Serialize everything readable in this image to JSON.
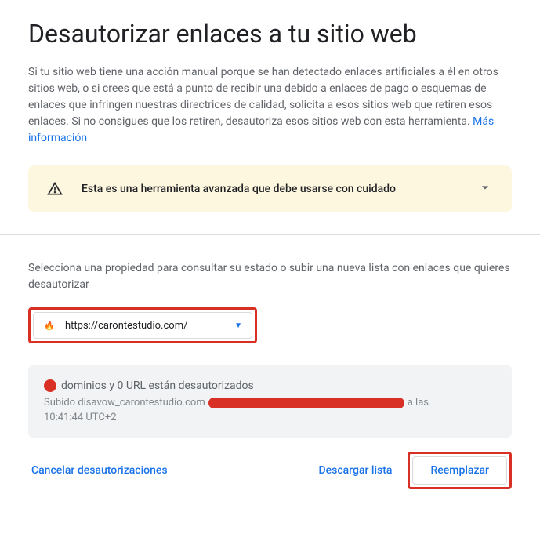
{
  "title": "Desautorizar enlaces a tu sitio web",
  "description": "Si tu sitio web tiene una acción manual porque se han detectado enlaces artificiales a él en otros sitios web, o si crees que está a punto de recibir una debido a enlaces de pago o esquemas de enlaces que infringen nuestras directrices de calidad, solicita a esos sitios web que retiren esos enlaces. Si no consigues que los retiren, desautoriza esos sitios web con esta herramienta. ",
  "more_info_label": "Más información",
  "warning": {
    "text": "Esta es una herramienta avanzada que debe usarse con cuidado"
  },
  "select_label": "Selecciona una propiedad para consultar su estado o subir una nueva lista con enlaces que quieres desautorizar",
  "property": {
    "url": "https://carontestudio.com/"
  },
  "status": {
    "summary": "dominios y 0 URL están desautorizados",
    "uploaded_prefix": "Subido disavow_carontestudio.com",
    "uploaded_suffix": " a las",
    "time": "10:41:44 UTC+2"
  },
  "actions": {
    "cancel": "Cancelar desautorizaciones",
    "download": "Descargar lista",
    "replace": "Reemplazar"
  }
}
